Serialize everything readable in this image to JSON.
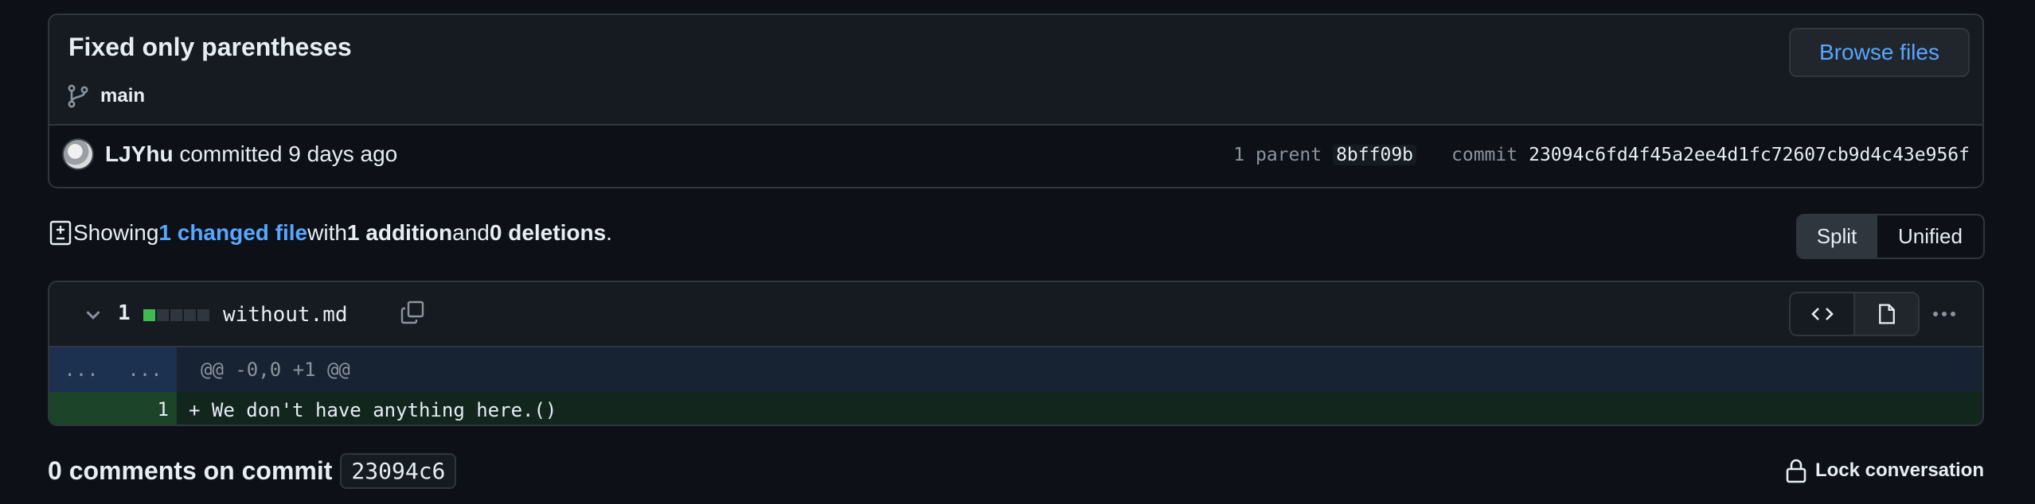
{
  "commit": {
    "title": "Fixed only parentheses",
    "branch": "main",
    "browse_files_label": "Browse files",
    "author": "LJYhu",
    "action_text": " committed 9 days ago",
    "parent_label": "1 parent",
    "parent_sha": "8bff09b",
    "commit_label": "commit",
    "commit_sha": "23094c6fd4f45a2ee4d1fc72607cb9d4c43e956f"
  },
  "summary": {
    "prefix": "Showing ",
    "changed_files": "1 changed file",
    "with": " with ",
    "additions": "1 addition",
    "and": " and ",
    "deletions": "0 deletions",
    "suffix": "."
  },
  "view_toggle": {
    "split_label": "Split",
    "unified_label": "Unified",
    "selected": "Split"
  },
  "file": {
    "change_count": "1",
    "diffstat": [
      "add",
      "none",
      "none",
      "none",
      "none"
    ],
    "name": "without.md",
    "hunk_gutter_left": "...",
    "hunk_gutter_right": "...",
    "hunk_header": "@@ -0,0 +1 @@",
    "lines": [
      {
        "new_line_number": "1",
        "text": "+ We don't have anything here.()"
      }
    ]
  },
  "comments": {
    "title": "0 comments on commit",
    "sha": "23094c6",
    "lock_label": "Lock conversation"
  },
  "colors": {
    "background": "#0d1117",
    "link": "#58a6ff",
    "addition": "#3fb950",
    "border": "#30363d"
  }
}
